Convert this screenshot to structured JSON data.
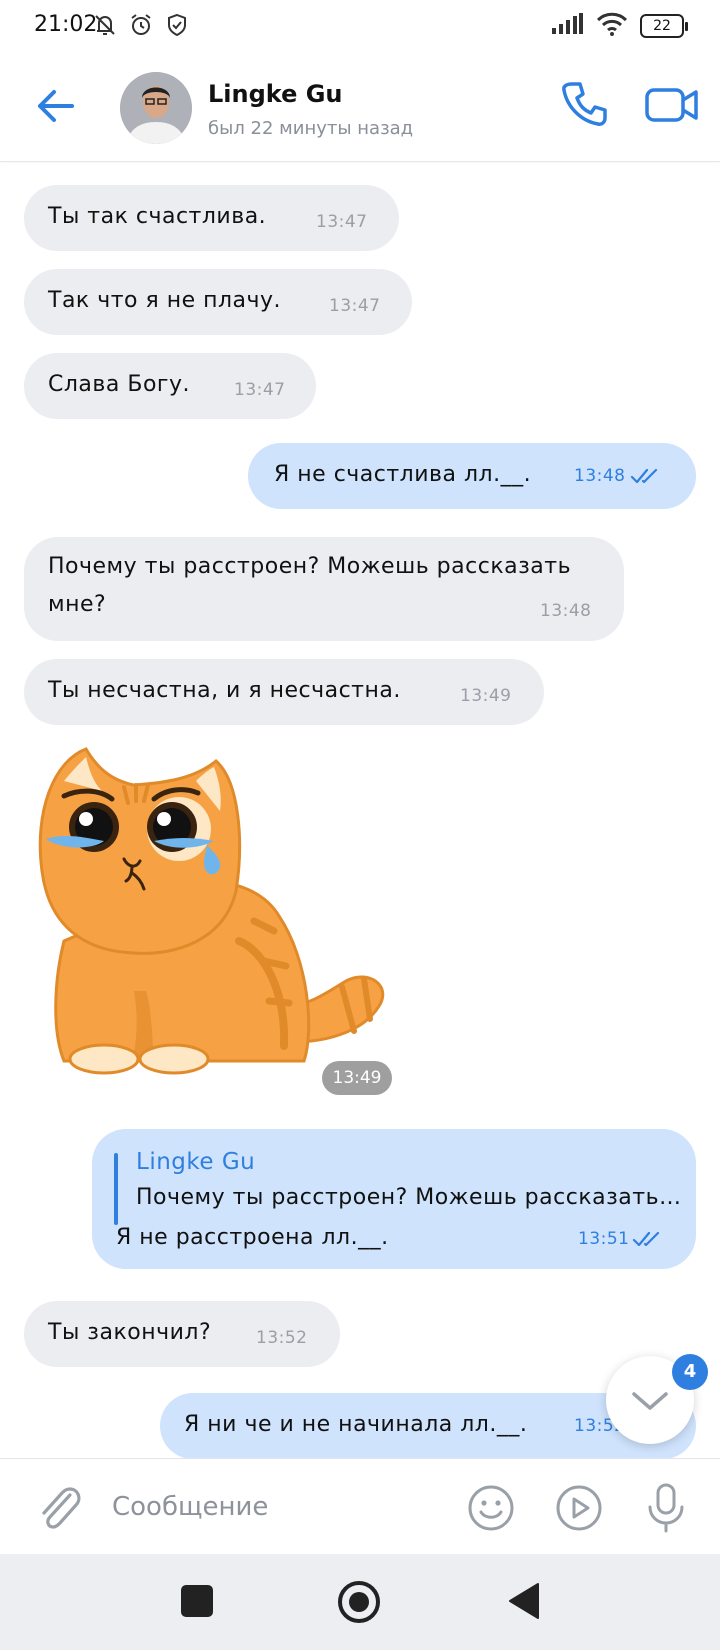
{
  "status_bar": {
    "time": "21:02",
    "battery": "22",
    "icons": [
      "mute-icon",
      "alarm-icon",
      "shield-icon",
      "signal-icon",
      "wifi-icon",
      "battery-icon"
    ]
  },
  "header": {
    "contact_name": "Lingke Gu",
    "last_seen": "был 22 минуты назад"
  },
  "messages": [
    {
      "dir": "in",
      "text": "Ты так счастлива.",
      "time": "13:47"
    },
    {
      "dir": "in",
      "text": "Так что я не плачу.",
      "time": "13:47"
    },
    {
      "dir": "in",
      "text": "Слава Богу.",
      "time": "13:47"
    },
    {
      "dir": "out",
      "text": "Я не счастлива лл.__.",
      "time": "13:48"
    },
    {
      "dir": "in",
      "text_line1": "Почему ты расстроен? Можешь рассказать",
      "text_line2": "мне?",
      "time": "13:48"
    },
    {
      "dir": "in",
      "text": "Ты несчастна, и я несчастна.",
      "time": "13:49"
    },
    {
      "dir": "in",
      "type": "sticker",
      "sticker": "crying-cat",
      "time": "13:49"
    },
    {
      "dir": "out",
      "reply_to_name": "Lingke Gu",
      "reply_to_text": "Почему ты расстроен? Можешь рассказать…",
      "text": "Я не расстроена лл.__.",
      "time": "13:51"
    },
    {
      "dir": "in",
      "text": "Ты закончил?",
      "time": "13:52"
    },
    {
      "dir": "out",
      "text": "Я ни че и не начинала лл.__.",
      "time": "13:52"
    }
  ],
  "scroll_badge": "4",
  "composer": {
    "placeholder": "Сообщение"
  },
  "colors": {
    "accent": "#2e7fe0",
    "incoming_bubble": "#ecedf1",
    "outgoing_bubble": "#cfe3fd"
  }
}
